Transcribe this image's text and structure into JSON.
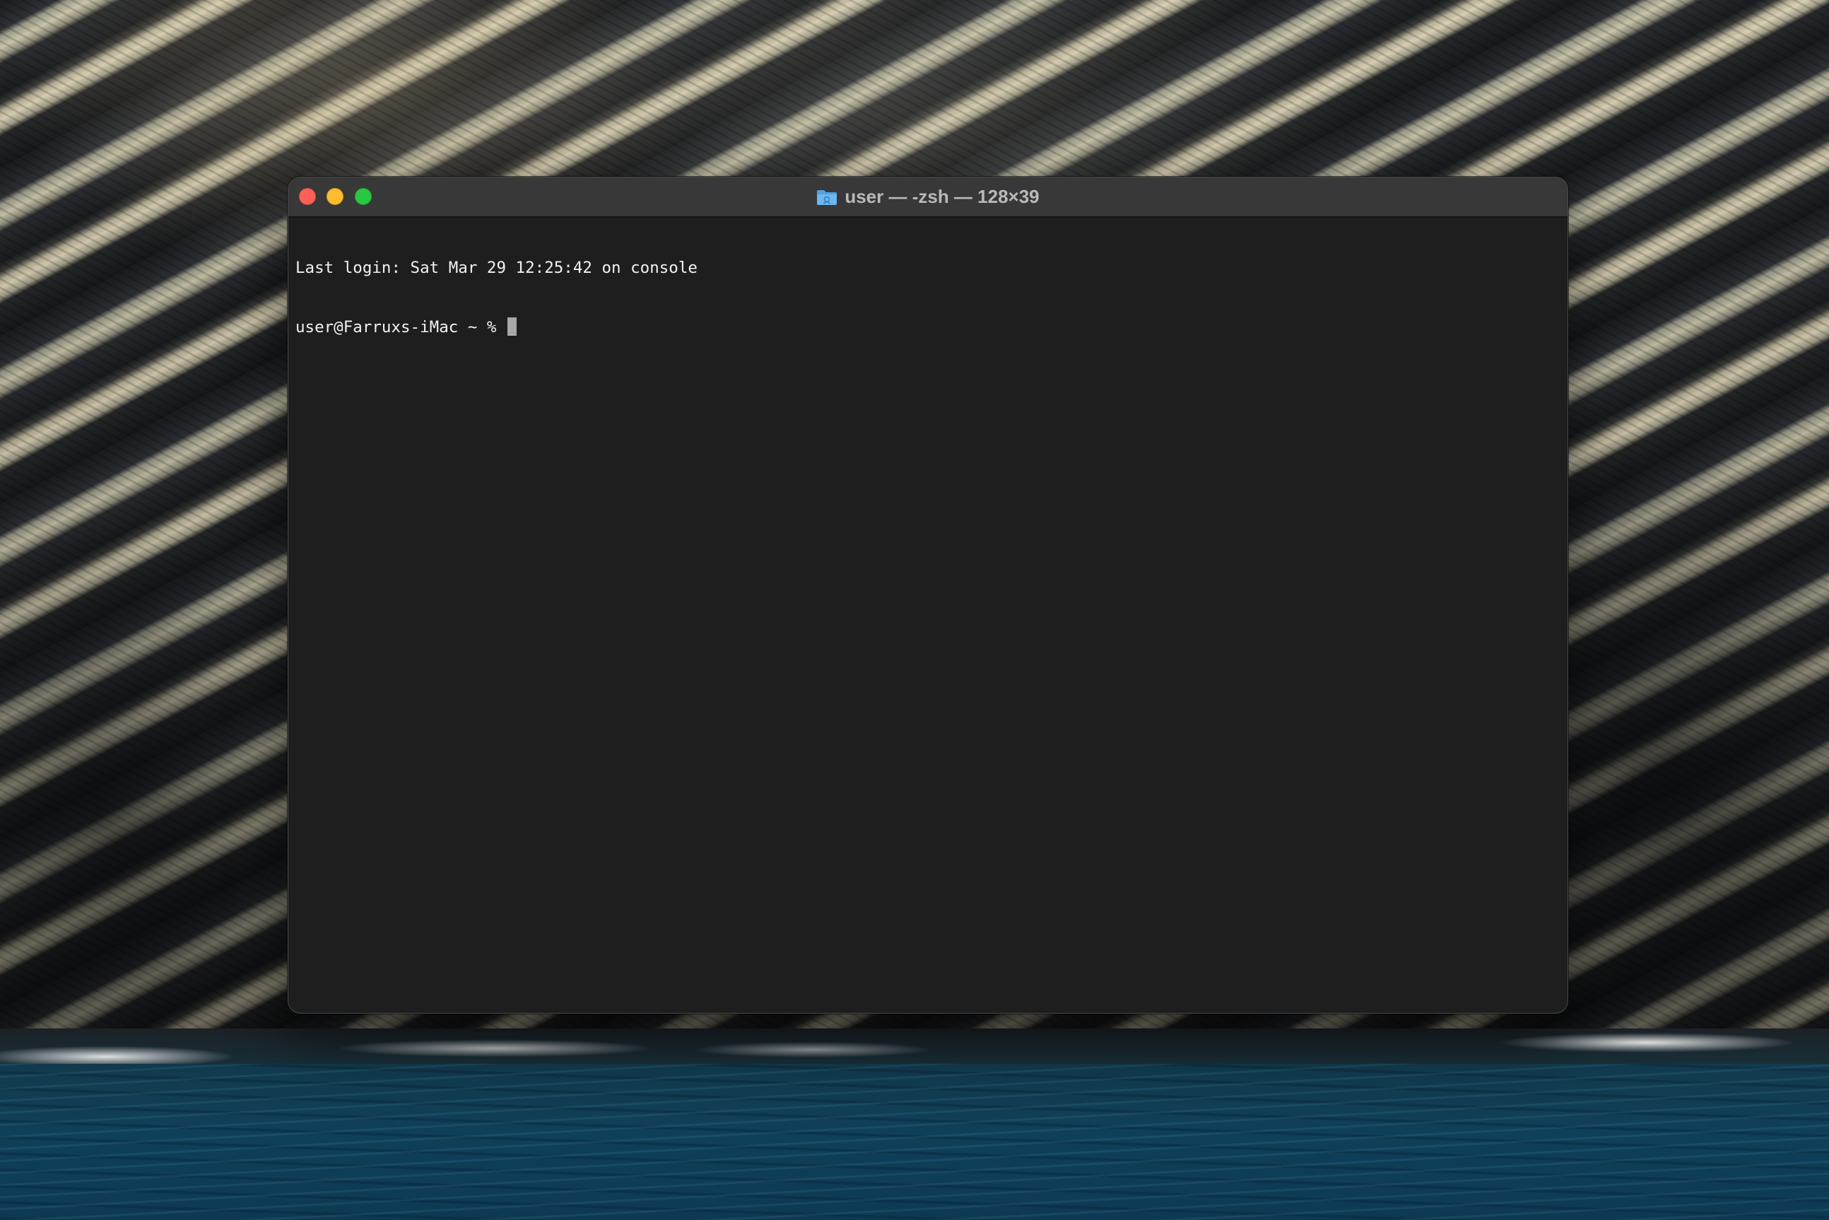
{
  "window": {
    "title": "user — -zsh — 128×39",
    "title_icon": "folder-icon"
  },
  "terminal": {
    "lines": [
      "Last login: Sat Mar 29 12:25:42 on console",
      "user@Farruxs-iMac ~ % "
    ]
  },
  "colors": {
    "close": "#fe5f57",
    "minimize": "#febc2e",
    "zoom": "#28c840",
    "terminal_bg": "#1e1e1e",
    "titlebar_bg": "#383838",
    "text": "#f2f2f2"
  }
}
